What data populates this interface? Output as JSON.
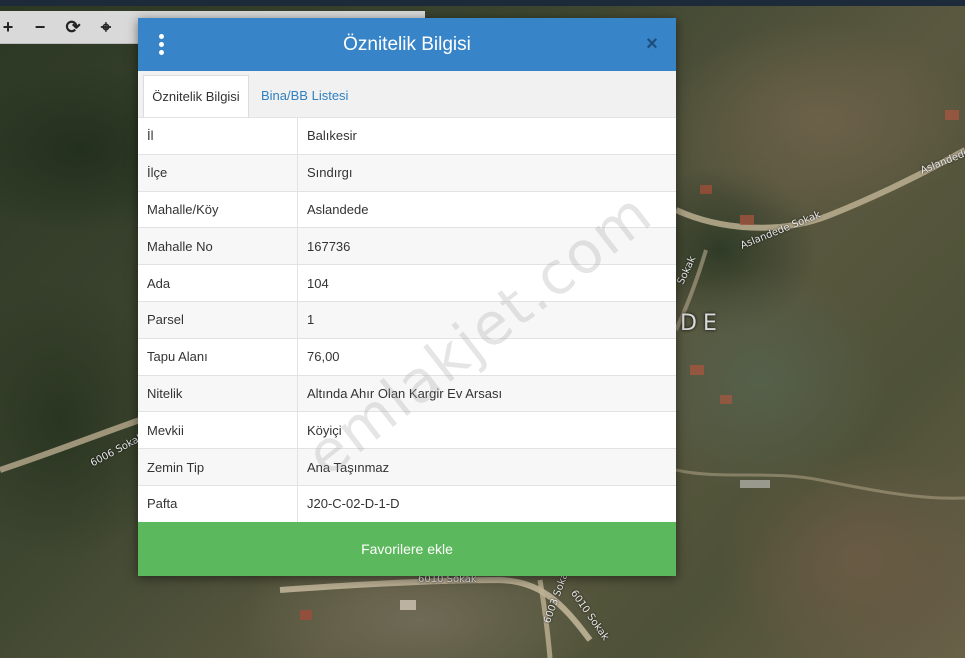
{
  "map": {
    "labels": [
      "Aslandede Sokak",
      "Aslandede Sokak",
      "6006 Sokak",
      "6010 Sokak",
      "6010 Sokak",
      "6003 Sokak",
      "Sokak"
    ],
    "place_label": "DE"
  },
  "toolbar": {
    "zoom_in": "+",
    "zoom_out": "−",
    "refresh": "⟳",
    "locate": "⌖"
  },
  "dialog": {
    "title": "Öznitelik Bilgisi",
    "close": "×",
    "tabs": [
      {
        "label": "Öznitelik Bilgisi",
        "active": true
      },
      {
        "label": "Bina/BB Listesi",
        "active": false
      }
    ],
    "rows": [
      {
        "key": "İl",
        "value": "Balıkesir"
      },
      {
        "key": "İlçe",
        "value": "Sındırgı"
      },
      {
        "key": "Mahalle/Köy",
        "value": "Aslandede"
      },
      {
        "key": "Mahalle No",
        "value": "167736"
      },
      {
        "key": "Ada",
        "value": "104"
      },
      {
        "key": "Parsel",
        "value": "1"
      },
      {
        "key": "Tapu Alanı",
        "value": "76,00"
      },
      {
        "key": "Nitelik",
        "value": "Altında Ahır Olan Kargir Ev Arsası"
      },
      {
        "key": "Mevkii",
        "value": "Köyiçi"
      },
      {
        "key": "Zemin Tip",
        "value": "Ana Taşınmaz"
      },
      {
        "key": "Pafta",
        "value": "J20-C-02-D-1-D"
      }
    ],
    "favorite_button": "Favorilere ekle"
  },
  "watermark": "emlakjet.com",
  "colors": {
    "header": "#3784c9",
    "favorite": "#5cb85c",
    "tab_link": "#2f7fc1"
  },
  "icons": [
    "menu-icon",
    "close-icon",
    "plus-icon",
    "minus-icon",
    "refresh-icon",
    "crosshair-icon"
  ]
}
